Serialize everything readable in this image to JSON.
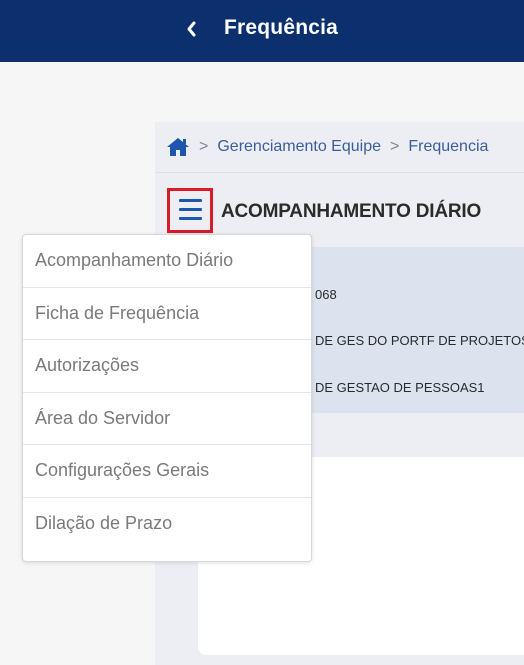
{
  "topbar": {
    "title": "Frequência",
    "back_icon": "chevron-left-icon",
    "background": "#0c2f6e"
  },
  "breadcrumb": {
    "home_icon": "home-icon",
    "items": [
      "Gerenciamento Equipe",
      "Frequencia"
    ],
    "separator": ">"
  },
  "header": {
    "menu_icon": "hamburger-menu-icon",
    "highlight_color": "#d81b27",
    "title": "ACOMPANHAMENTO DIÁRIO"
  },
  "info": {
    "line1": "068",
    "line2": "DE GES DO PORTF DE PROJETOS",
    "line3": "DE GESTAO DE PESSOAS1"
  },
  "menu": {
    "items": [
      "Acompanhamento Diário",
      "Ficha de Frequência",
      "Autorizações",
      "Área do Servidor",
      "Configurações Gerais",
      "Dilação de Prazo"
    ]
  }
}
